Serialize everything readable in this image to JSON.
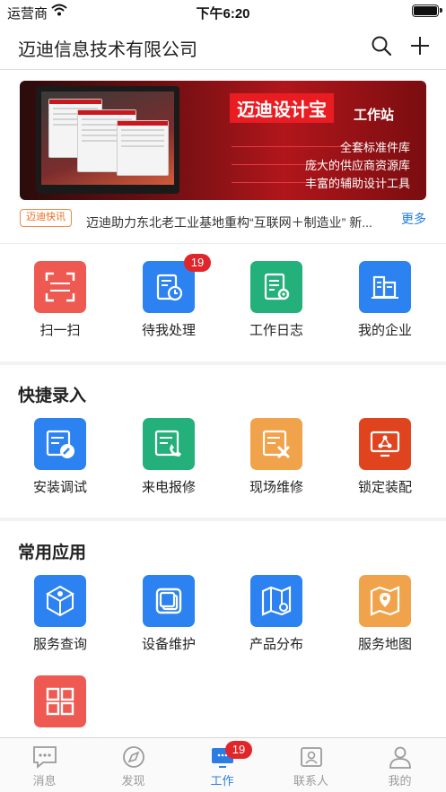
{
  "status_bar": {
    "carrier": "运营商",
    "time": "下午6:20"
  },
  "nav": {
    "title": "迈迪信息技术有限公司",
    "search_icon": "search-icon",
    "add_icon": "plus-icon"
  },
  "banner": {
    "brand": "迈迪设计宝",
    "subtitle": "工作站",
    "features": [
      "全套标准件库",
      "庞大的供应商资源库",
      "丰富的辅助设计工具"
    ]
  },
  "news": {
    "tag": "迈迪快讯",
    "headline": "迈迪助力东北老工业基地重构“互联网＋制造业” 新...",
    "more": "更多"
  },
  "top_grid": [
    {
      "label": "扫一扫",
      "icon": "scan-icon",
      "color": "#ee5a52"
    },
    {
      "label": "待我处理",
      "icon": "todo-clock-icon",
      "color": "#2b82f0",
      "badge": "19"
    },
    {
      "label": "工作日志",
      "icon": "worklog-icon",
      "color": "#23b07a"
    },
    {
      "label": "我的企业",
      "icon": "company-building-icon",
      "color": "#2b82f0"
    }
  ],
  "quick_entry": {
    "title": "快捷录入",
    "items": [
      {
        "label": "安装调试",
        "icon": "install-wrench-icon",
        "color": "#2b82f0"
      },
      {
        "label": "来电报修",
        "icon": "phone-repair-icon",
        "color": "#23b07a"
      },
      {
        "label": "现场维修",
        "icon": "onsite-repair-icon",
        "color": "#f0a34a"
      },
      {
        "label": "锁定装配",
        "icon": "lock-assembly-icon",
        "color": "#e0441e"
      }
    ]
  },
  "common_apps": {
    "title": "常用应用",
    "items": [
      {
        "label": "服务查询",
        "icon": "service-query-icon",
        "color": "#2b82f0"
      },
      {
        "label": "设备维护",
        "icon": "device-maintain-icon",
        "color": "#2b82f0"
      },
      {
        "label": "产品分布",
        "icon": "product-map-icon",
        "color": "#2b82f0"
      },
      {
        "label": "服务地图",
        "icon": "service-map-icon",
        "color": "#f0a34a"
      },
      {
        "label": "",
        "icon": "grid-apps-icon",
        "color": "#ee5a52"
      }
    ]
  },
  "tabs": [
    {
      "label": "消息",
      "icon": "message-icon"
    },
    {
      "label": "发现",
      "icon": "compass-icon"
    },
    {
      "label": "工作",
      "icon": "work-icon",
      "active": true,
      "badge": "19"
    },
    {
      "label": "联系人",
      "icon": "contacts-icon"
    },
    {
      "label": "我的",
      "icon": "profile-icon"
    }
  ]
}
